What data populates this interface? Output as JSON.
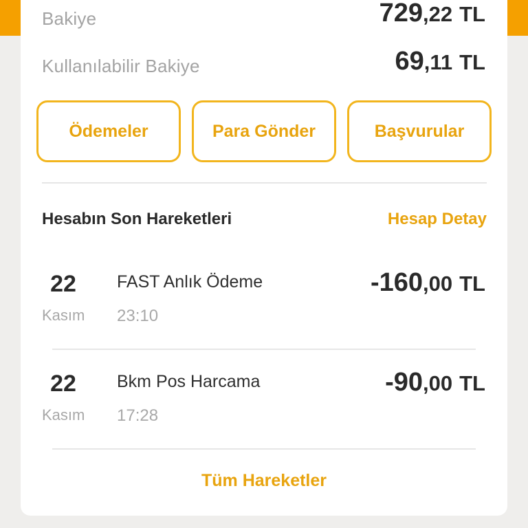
{
  "balance": {
    "label": "Bakiye",
    "int": "729",
    "dec": ",22",
    "currency": "TL"
  },
  "available": {
    "label": "Kullanılabilir Bakiye",
    "int": "69",
    "dec": ",11",
    "currency": "TL"
  },
  "actions": [
    {
      "label": "Ödemeler"
    },
    {
      "label": "Para Gönder"
    },
    {
      "label": "Başvurular"
    }
  ],
  "recent": {
    "title": "Hesabın Son Hareketleri",
    "detail_link": "Hesap Detay",
    "transactions": [
      {
        "day": "22",
        "month": "Kasım",
        "title": "FAST Anlık Ödeme",
        "time": "23:10",
        "int": "-160",
        "dec": ",00",
        "currency": "TL"
      },
      {
        "day": "22",
        "month": "Kasım",
        "title": "Bkm Pos Harcama",
        "time": "17:28",
        "int": "-90",
        "dec": ",00",
        "currency": "TL"
      }
    ],
    "all_link": "Tüm Hareketler"
  },
  "colors": {
    "accent": "#f5a000",
    "button_border": "#f2b51d",
    "button_text": "#e8a40f",
    "background": "#efeeec"
  }
}
